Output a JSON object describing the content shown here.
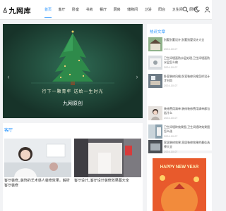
{
  "site": {
    "name": "九网库"
  },
  "nav": {
    "items": [
      "首页",
      "客厅",
      "卧室",
      "书房",
      "餐厅",
      "厨房",
      "储物间",
      "卫浴",
      "阳台",
      "卫生间",
      "厨柜"
    ]
  },
  "hero": {
    "tag": "推荐",
    "poem": "行下一颗青年 送给一生时光",
    "caption": "九网原创"
  },
  "section": {
    "title": "客厅",
    "cards": [
      {
        "title": "客厅装修_装饰的艺术感人装修效果，解析客厅装修"
      },
      {
        "title": "客厅设计_客厅设计装修效果图大全"
      }
    ]
  },
  "sidebar": {
    "title": "热评文章",
    "items": [
      {
        "text": "别墅别墅设计,别墅别墅设计大全",
        "date": "2024-10-07"
      },
      {
        "text": "卫生间墙面防水层处理,卫生间墙面防水层怎么做",
        "date": "2024-10-07"
      },
      {
        "text": "卧室装修风格,卧室装修风格怎样设计才时尚",
        "date": "2024-10-07"
      },
      {
        "text": "装修费用清单,装修装修费用清单都包括什么",
        "date": "2024-10-07"
      },
      {
        "text": "卫生间墙砖效果图,卫生间墙砖效果图怎么选",
        "date": "2024-10-07"
      },
      {
        "text": "家居装修效果,家居装修效果的最佳选择大全",
        "date": "2024-10-07"
      }
    ]
  },
  "ad": {
    "text": "HAPPY NEW YEAR"
  },
  "colors": {
    "accent": "#1e90ff",
    "hero_bg": "#1f4437",
    "ad_bg": "#e85a2c"
  }
}
